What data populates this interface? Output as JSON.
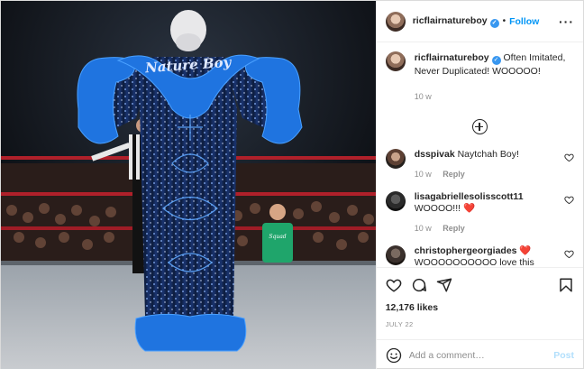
{
  "header": {
    "username": "ricflairnatureboy",
    "follow_label": "Follow",
    "separator": "•"
  },
  "caption": {
    "username": "ricflairnatureboy",
    "text": "Often Imitated, Never Duplicated! WOOOOO!",
    "time": "10 w"
  },
  "comments": [
    {
      "username": "dsspivak",
      "text": "Naytchah Boy!",
      "time": "10 w",
      "reply_label": "Reply"
    },
    {
      "username": "lisagabriellesolisscott11",
      "text": "WOOOO!!! ❤️",
      "time": "10 w",
      "reply_label": "Reply"
    },
    {
      "username": "christophergeorgiades",
      "text": "❤️ WOOOOOOOOOO love this Robe too"
    }
  ],
  "robe_text": "Nature Boy",
  "shirt_text": "Squad",
  "likes": "12,176 likes",
  "date": "JULY 22",
  "add_comment": {
    "placeholder": "Add a comment…",
    "post_label": "Post"
  },
  "icons": [
    "heart-icon",
    "comment-icon",
    "share-icon",
    "bookmark-icon",
    "emoji-icon",
    "more-icon",
    "verified-icon",
    "plus-circle-icon"
  ],
  "colors": {
    "accent": "#0095f6",
    "feather_blue": "#1f74e0",
    "post_disabled": "#b2dffc",
    "like_red": "#ed4956"
  }
}
